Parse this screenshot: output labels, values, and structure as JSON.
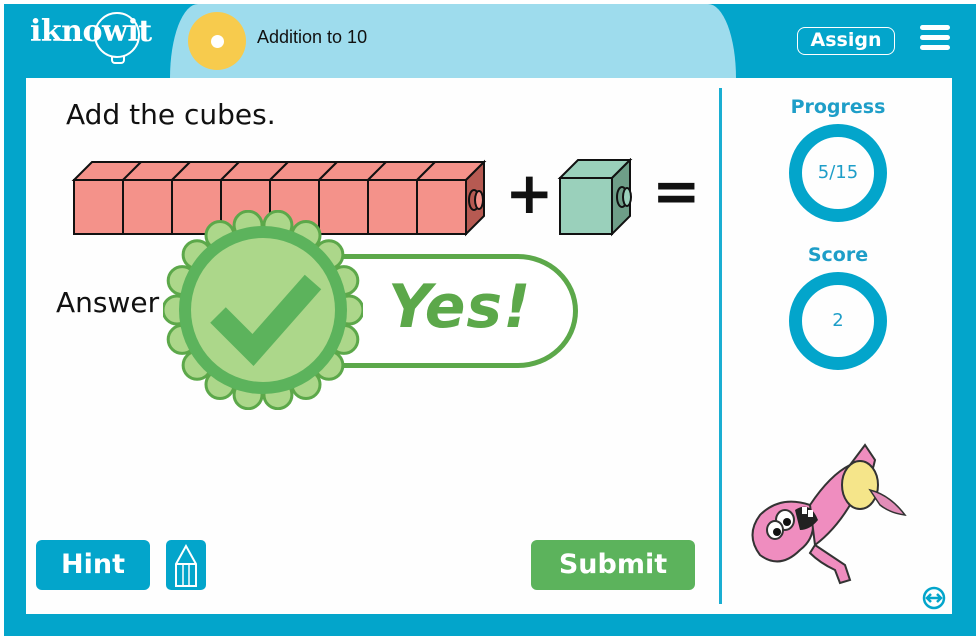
{
  "header": {
    "logo_text": "iknowit",
    "lesson_title": "Addition to 10",
    "assign_label": "Assign",
    "menu_icon": "hamburger-menu-icon",
    "sun_icon": "sun-icon"
  },
  "question": {
    "prompt": "Add the cubes.",
    "addend_a_cubes": 8,
    "addend_b_cubes": 1,
    "cube_colors": {
      "red": "#f4928a",
      "red_side": "#b65a52",
      "green": "#9ad0bb",
      "green_side": "#6e9e88"
    },
    "plus_sign": "+",
    "equals_sign": "=",
    "answer_label": "Answer"
  },
  "feedback": {
    "text": "Yes!",
    "icon": "checkmark-badge-icon",
    "colors": {
      "dark": "#5ca84a",
      "medium": "#5cb35c",
      "light": "#acd78a"
    }
  },
  "sidebar": {
    "progress_label": "Progress",
    "progress_value": "5/15",
    "score_label": "Score",
    "score_value": "2",
    "mascot": "pink-monster-mascot",
    "swap_icon": "swap-arrows-icon"
  },
  "footer": {
    "hint_label": "Hint",
    "pencil_icon": "pencil-icon",
    "submit_label": "Submit"
  },
  "colors": {
    "brand_blue": "#03a5cb",
    "header_light": "#9edced",
    "sun_yellow": "#f7cb4d",
    "submit_green": "#5cb35c"
  }
}
